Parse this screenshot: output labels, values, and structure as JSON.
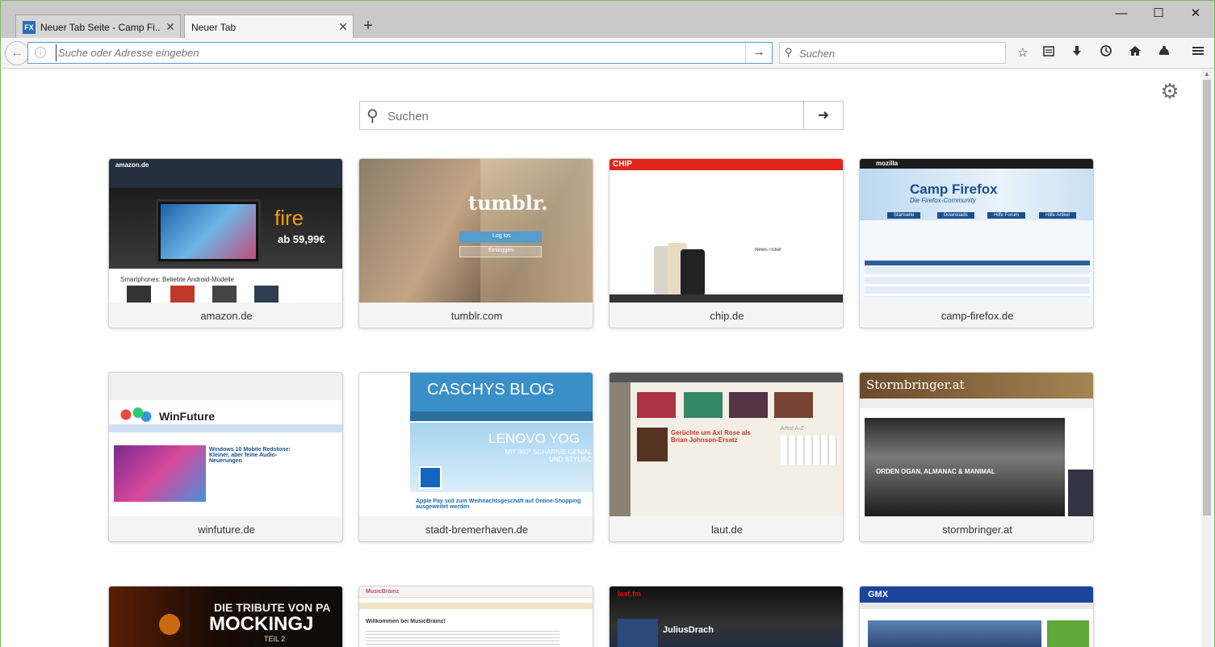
{
  "window": {
    "tabs": [
      {
        "title": "Neuer Tab Seite - Camp Fi...",
        "favicon": "FX",
        "active": false
      },
      {
        "title": "Neuer Tab",
        "active": true
      }
    ],
    "new_tab_symbol": "+",
    "controls": {
      "minimize": "—",
      "maximize": "☐",
      "close": "✕"
    }
  },
  "navbar": {
    "url_placeholder": "Suche oder Adresse eingeben",
    "search_placeholder": "Suchen",
    "toolbar_icons": [
      "star-icon",
      "reading-list-icon",
      "download-icon",
      "history-icon",
      "home-icon",
      "pocket-icon",
      "menu-icon"
    ]
  },
  "newtab": {
    "search_placeholder": "Suchen",
    "tiles": [
      {
        "label": "amazon.de",
        "thumb": {
          "promo_text": "fire",
          "price": "ab 59,99€",
          "subhead": "Smartphones: Beliebte Android-Modelle",
          "brand": "amazon.de"
        }
      },
      {
        "label": "tumblr.com",
        "thumb": {
          "logo": "tumblr.",
          "login": "Log los",
          "signup": "Einloggen"
        }
      },
      {
        "label": "chip.de",
        "thumb": {
          "logo": "CHIP",
          "ticker": "News-Ticker"
        }
      },
      {
        "label": "camp-firefox.de",
        "thumb": {
          "title": "Camp Firefox",
          "subtitle": "Die Firefox-Community",
          "nav": [
            "Startseite",
            "Downloads",
            "Hilfe Forum",
            "Hilfe Artikel"
          ],
          "brand": "mozilla"
        }
      },
      {
        "label": "winfuture.de",
        "thumb": {
          "logo": "WinFuture",
          "headline": "Windows 10 Mobile Redstone: Kleiner, aber feine Audio-Neuerungen"
        }
      },
      {
        "label": "stadt-bremerhaven.de",
        "thumb": {
          "logo": "CASCHYS BLOG",
          "ad_head": "LENOVO YOG",
          "ad_sub": "MIT 360° SCHARNIE GENIAL UND STYLISC",
          "news": "Apple Pay soll zum Weihnachtsgeschäft auf Online-Shopping ausgeweitet werden"
        }
      },
      {
        "label": "laut.de",
        "thumb": {
          "headline": "Gerüchte um Axl Rose als Brian Johnson-Ersatz",
          "sidebar": "Artist A-Z"
        }
      },
      {
        "label": "stormbringer.at",
        "thumb": {
          "logo": "Stormbringer.at",
          "caption": "ORDEN OGAN, ALMANAC & MANIMAL"
        }
      },
      {
        "label": "",
        "thumb": {
          "title": "DIE TRIBUTE VON PA",
          "main": "MOCKINGJ",
          "sub": "TEIL 2"
        }
      },
      {
        "label": "",
        "thumb": {
          "brand": "MusicBrainz",
          "welcome": "Willkommen bei MusicBrainz!"
        }
      },
      {
        "label": "",
        "thumb": {
          "brand": "last.fm",
          "user": "JuliusDrach"
        }
      },
      {
        "label": "",
        "thumb": {
          "brand": "GMX"
        }
      }
    ]
  },
  "colors": {
    "accent": "#5b9bd5",
    "window_border": "#7fb562"
  }
}
